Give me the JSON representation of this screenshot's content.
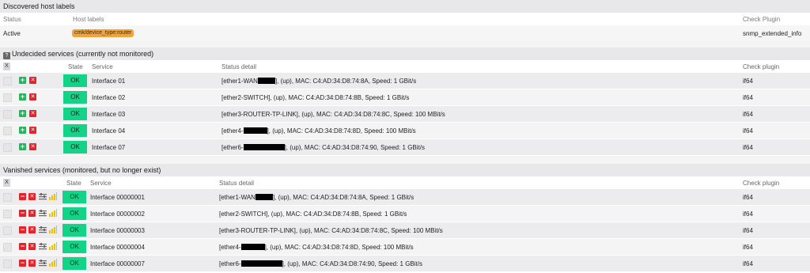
{
  "host_labels": {
    "title": "Discovered host labels",
    "headers": {
      "status": "Status",
      "labels": "Host labels",
      "plugin": "Check Plugin"
    },
    "row": {
      "status": "Active",
      "label": "cmk/device_type:router",
      "plugin": "snmp_extended_info"
    }
  },
  "undecided": {
    "title": "Undecided services (currently not monitored)",
    "help_icon": "?",
    "headers": {
      "x": "X",
      "state": "State",
      "service": "Service",
      "detail": "Status detail",
      "plugin": "Check plugin"
    },
    "rows": [
      {
        "state": "OK",
        "service": "Interface 01",
        "detail_pre": "[ether1-WAN",
        "detail_post": "], (up), MAC: C4:AD:34:D8:74:8A, Speed: 1 GBit/s",
        "plugin": "if64"
      },
      {
        "state": "OK",
        "service": "Interface 02",
        "detail_pre": "[ether2-SWITCH], (up), MAC: C4:AD:34:D8:74:8B, Speed: 1 GBit/s",
        "detail_post": "",
        "plugin": "if64"
      },
      {
        "state": "OK",
        "service": "Interface 03",
        "detail_pre": "[ether3-ROUTER-TP-LINK], (up), MAC: C4:AD:34:D8:74:8C, Speed: 100 MBit/s",
        "detail_post": "",
        "plugin": "if64"
      },
      {
        "state": "OK",
        "service": "Interface 04",
        "detail_pre": "[ether4-",
        "detail_post": "], (up), MAC: C4:AD:34:D8:74:8D, Speed: 100 MBit/s",
        "plugin": "if64"
      },
      {
        "state": "OK",
        "service": "Interface 07",
        "detail_pre": "[ether6-",
        "detail_post": "], (up), MAC: C4:AD:34:D8:74:90, Speed: 1 GBit/s",
        "plugin": "if64"
      }
    ]
  },
  "vanished": {
    "title": "Vanished services (monitored, but no longer exist)",
    "headers": {
      "x": "X",
      "state": "State",
      "service": "Service",
      "detail": "Status detail",
      "plugin": "Check plugin"
    },
    "rows": [
      {
        "state": "OK",
        "service": "Interface 00000001",
        "detail_pre": "[ether1-WAN",
        "detail_post": "], (up), MAC: C4:AD:34:D8:74:8A, Speed: 1 GBit/s",
        "plugin": "if64"
      },
      {
        "state": "OK",
        "service": "Interface 00000002",
        "detail_pre": "[ether2-SWITCH], (up), MAC: C4:AD:34:D8:74:8B, Speed: 1 GBit/s",
        "detail_post": "",
        "plugin": "if64"
      },
      {
        "state": "OK",
        "service": "Interface 00000003",
        "detail_pre": "[ether3-ROUTER-TP-LINK], (up), MAC: C4:AD:34:D8:74:8C, Speed: 100 MBit/s",
        "detail_post": "",
        "plugin": "if64"
      },
      {
        "state": "OK",
        "service": "Interface 00000004",
        "detail_pre": "[ether4-",
        "detail_post": "], (up), MAC: C4:AD:34:D8:74:8D, Speed: 100 MBit/s",
        "plugin": "if64"
      },
      {
        "state": "OK",
        "service": "Interface 00000007",
        "detail_pre": "[ether6-",
        "detail_post": "], (up), MAC: C4:AD:34:D8:74:90, Speed: 1 GBit/s",
        "plugin": "if64"
      }
    ]
  },
  "colors": {
    "ok": "#13d389",
    "add": "#25b55c",
    "remove": "#e0252c",
    "label_badge": "#f0a53c"
  }
}
